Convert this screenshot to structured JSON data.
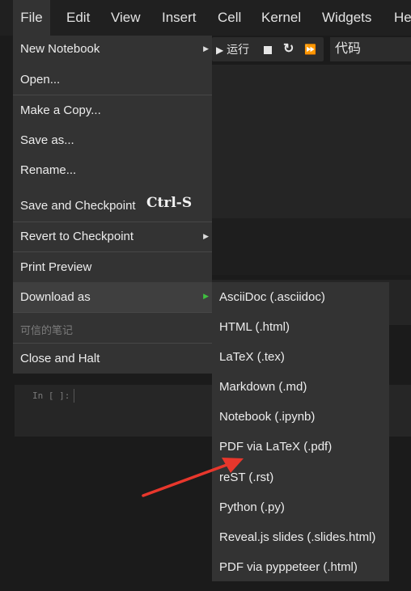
{
  "menubar": {
    "items": [
      {
        "label": "File"
      },
      {
        "label": "Edit"
      },
      {
        "label": "View"
      },
      {
        "label": "Insert"
      },
      {
        "label": "Cell"
      },
      {
        "label": "Kernel"
      },
      {
        "label": "Widgets"
      },
      {
        "label": "He"
      }
    ]
  },
  "toolbar": {
    "run_label": "运行",
    "cell_type": "代码"
  },
  "cell": {
    "prompt": "In [ ]:"
  },
  "file_menu": {
    "items": [
      {
        "label": "New Notebook"
      },
      {
        "label": "Open..."
      },
      {
        "label": "Make a Copy..."
      },
      {
        "label": "Save as..."
      },
      {
        "label": "Rename..."
      },
      {
        "label": "Save and Checkpoint",
        "shortcut": "Ctrl-S"
      },
      {
        "label": "Revert to Checkpoint"
      },
      {
        "label": "Print Preview"
      },
      {
        "label": "Download as"
      },
      {
        "label": "可信的笔记"
      },
      {
        "label": "Close and Halt"
      }
    ]
  },
  "download_submenu": {
    "items": [
      {
        "label": "AsciiDoc (.asciidoc)"
      },
      {
        "label": "HTML (.html)"
      },
      {
        "label": "LaTeX (.tex)"
      },
      {
        "label": "Markdown (.md)"
      },
      {
        "label": "Notebook (.ipynb)"
      },
      {
        "label": "PDF via LaTeX (.pdf)"
      },
      {
        "label": "reST (.rst)"
      },
      {
        "label": "Python (.py)"
      },
      {
        "label": "Reveal.js slides (.slides.html)"
      },
      {
        "label": "PDF via pyppeteer (.html)"
      }
    ]
  },
  "colors": {
    "annotation_arrow": "#e8372c",
    "submenu_arrow_active": "#3fbf3f"
  }
}
